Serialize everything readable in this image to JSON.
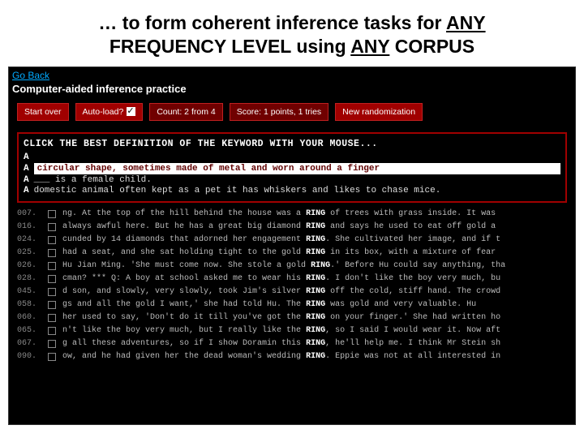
{
  "slide_title_pre": "… to form coherent inference tasks for ",
  "slide_title_u1": "ANY",
  "slide_title_mid": " FREQUENCY LEVEL using ",
  "slide_title_u2": "ANY",
  "slide_title_post": " CORPUS",
  "goback": "Go Back",
  "app_title": "Computer-aided inference practice",
  "toolbar": {
    "start_over": "Start over",
    "auto_load": "Auto-load?",
    "count": "Count: 2 from 4",
    "score": "Score: 1 points, 1 tries",
    "new_random": "New randomization"
  },
  "instruction": "CLICK THE BEST DEFINITION OF THE KEYWORD WITH YOUR MOUSE...",
  "definitions": [
    {
      "marker": "A",
      "text": " "
    },
    {
      "marker": "A",
      "text": "circular shape, sometimes made of metal and worn around a finger",
      "hl": true
    },
    {
      "marker": "A",
      "text": " ___ is a female child."
    },
    {
      "marker": "A",
      "text": "domestic animal often kept as a pet it has whiskers and likes to chase mice."
    }
  ],
  "kw": "RING",
  "concord": [
    {
      "num": "007.",
      "pre": "ng. At the top of the hill behind the house was a ",
      "post": " of trees with grass inside. It was"
    },
    {
      "num": "016.",
      "pre": "always awful here. But he has a great big diamond ",
      "post": " and says he used to eat off gold a"
    },
    {
      "num": "024.",
      "pre": "cunded by 14 diamonds that adorned her engagement ",
      "post": ". She cultivated her image, and if t"
    },
    {
      "num": "025.",
      "pre": " had a seat, and she sat holding tight to the gold ",
      "post": " in its box, with a mixture of fear"
    },
    {
      "num": "026.",
      "pre": "Hu Jian Ming. 'She must come now. She stole a gold ",
      "post": ".' Before Hu could say anything, tha"
    },
    {
      "num": "028.",
      "pre": "cman? *** Q: A boy at school asked me to wear his ",
      "post": ". I don't like the boy very much, bu"
    },
    {
      "num": "045.",
      "pre": "d son, and slowly, very slowly, took Jim's silver ",
      "post": " off the cold, stiff hand. The crowd"
    },
    {
      "num": "058.",
      "pre": "gs and all the gold I want,' she had told Hu. The ",
      "post": " was gold and very valuable. Hu"
    },
    {
      "num": "060.",
      "pre": "her used to say, 'Don't do it till you've got the ",
      "post": " on your finger.' She had written ho"
    },
    {
      "num": "065.",
      "pre": "n't like the boy very much, but I really like the ",
      "post": ", so I said I would wear it. Now aft"
    },
    {
      "num": "067.",
      "pre": "g all these adventures, so if I show Doramin this ",
      "post": ", he'll help me. I think Mr Stein sh"
    },
    {
      "num": "090.",
      "pre": "ow, and he had given her the dead woman's wedding ",
      "post": ". Eppie was not at all interested in"
    }
  ]
}
